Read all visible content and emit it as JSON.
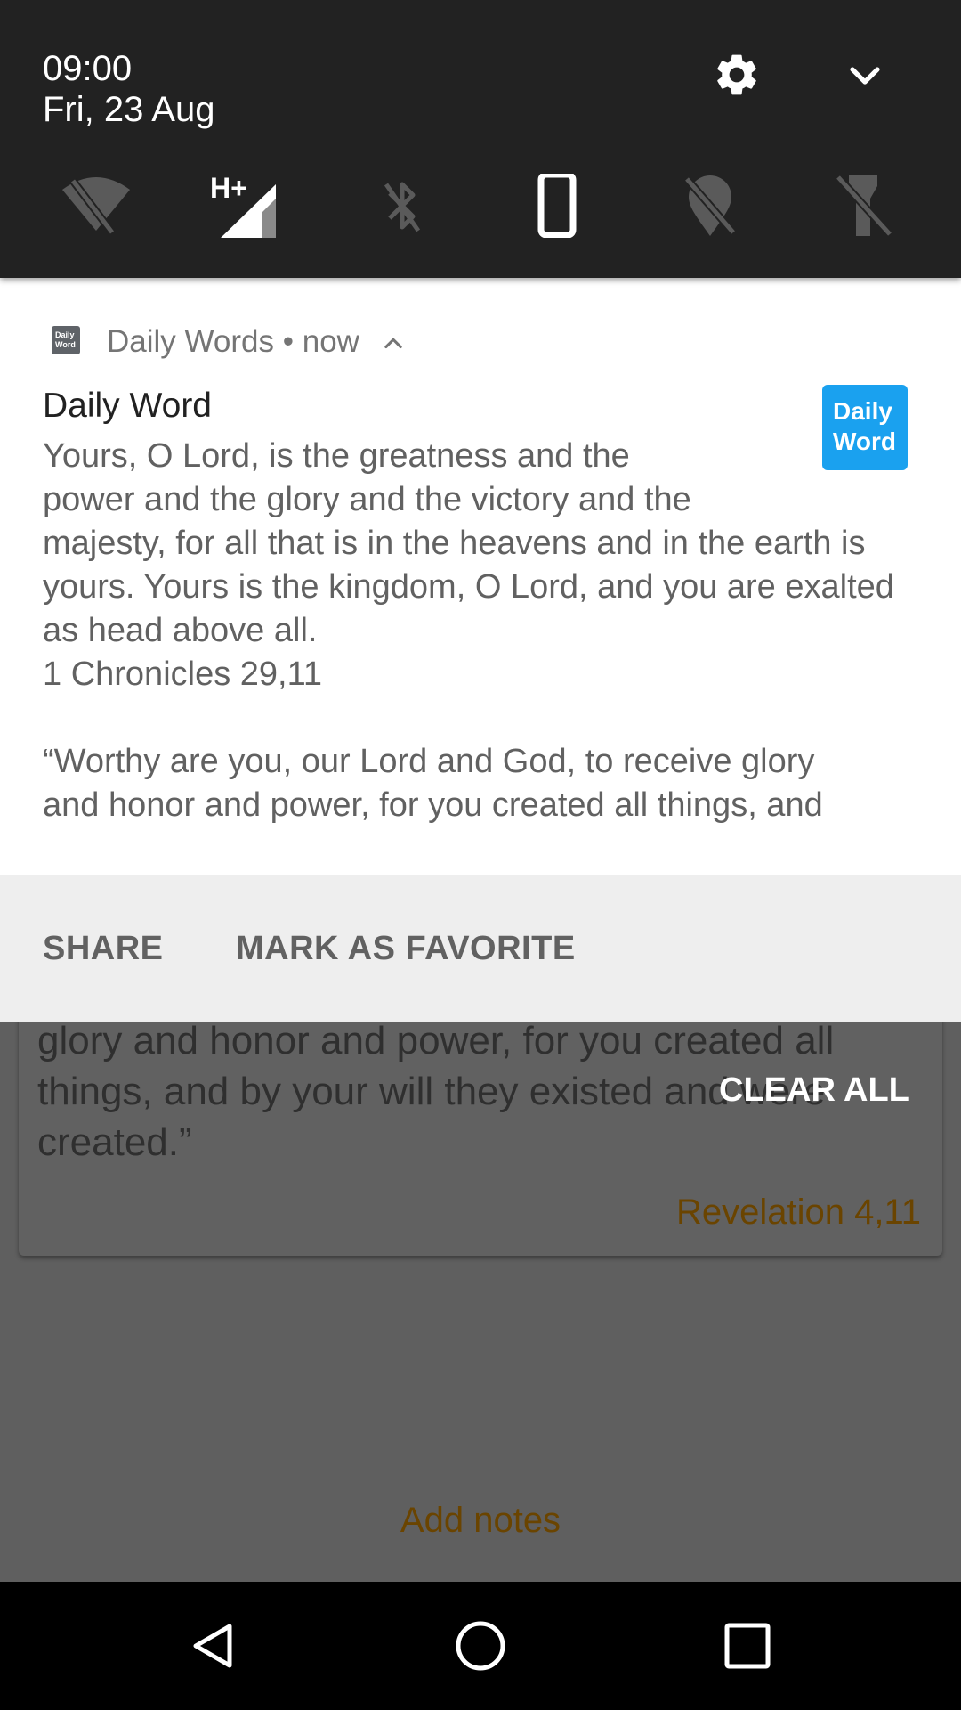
{
  "status": {
    "time": "09:00",
    "date": "Fri, 23 Aug",
    "network_label": "H+"
  },
  "quick_settings": {
    "icons": [
      "wifi-off-icon",
      "mobile-signal-icon",
      "bluetooth-off-icon",
      "auto-rotate-icon",
      "location-off-icon",
      "flashlight-off-icon"
    ],
    "settings_icon": "gear-icon",
    "expand_icon": "chevron-down-icon"
  },
  "notification": {
    "app_name": "Daily Words",
    "separator": "•",
    "timestamp": "now",
    "title": "Daily Word",
    "verse_1_line_1": "Yours, O Lord, is the greatness and the",
    "verse_1_line_2": "power and the glory and the victory and the",
    "verse_1_rest": "majesty, for all that is in the heavens and in the earth is yours. Yours is the kingdom, O Lord, and you are exalted as head above all.",
    "reference_1": "1 Chronicles 29,11",
    "verse_2_line_1": "“Worthy are you, our Lord and God, to receive glory",
    "verse_2_line_2": "and honor and power, for you created all things, and",
    "large_icon_line_1": "Daily",
    "large_icon_line_2": "Word",
    "app_icon_line_1": "Daily",
    "app_icon_line_2": "Word",
    "actions": {
      "share": "SHARE",
      "favorite": "MARK AS FAVORITE"
    }
  },
  "background_app": {
    "verse_text": "glory and honor and power, for you created all things, and by your will they existed and were created.”",
    "reference": "Revelation 4,11",
    "add_notes": "Add notes"
  },
  "shade": {
    "clear_all": "CLEAR ALL"
  },
  "navigation": {
    "icons": [
      "back-icon",
      "home-icon",
      "recents-icon"
    ]
  },
  "colors": {
    "header_bg": "#222222",
    "notification_bg": "#ffffff",
    "actions_bg": "#eeeeee",
    "app_accent": "#1aa1ef",
    "dimmed_app_bg": "#5f5f5f",
    "dimmed_link": "#6a4400"
  }
}
